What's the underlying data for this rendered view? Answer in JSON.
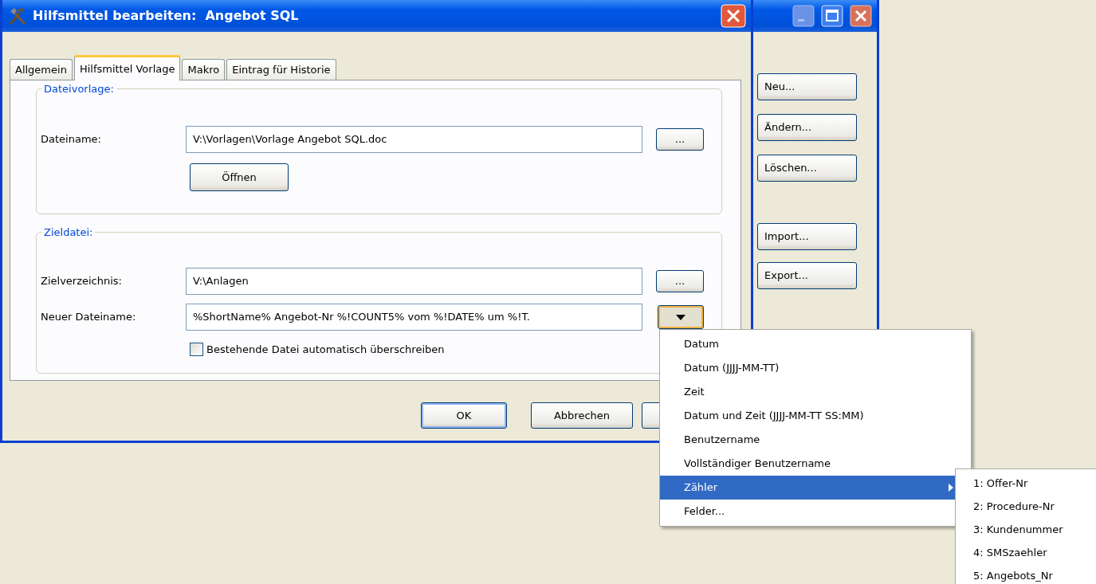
{
  "back_window": {
    "buttons": [
      "Neu...",
      "Ändern...",
      "Löschen...",
      "Import...",
      "Export..."
    ]
  },
  "dialog": {
    "title": "Hilfsmittel bearbeiten:  Angebot SQL",
    "tabs": [
      {
        "label": "Allgemein",
        "selected": false
      },
      {
        "label": "Hilfsmittel Vorlage",
        "selected": true
      },
      {
        "label": "Makro",
        "selected": false
      },
      {
        "label": "Eintrag für Historie",
        "selected": false
      }
    ],
    "groups": [
      {
        "title": "Dateivorlage:",
        "rows": [
          {
            "kind": "field",
            "label": "Dateiname:",
            "value": "V:\\Vorlagen\\Vorlage Angebot SQL.doc",
            "button": "..."
          },
          {
            "kind": "button",
            "label": "Öffnen"
          }
        ]
      },
      {
        "title": "Zieldatei:",
        "rows": [
          {
            "kind": "field",
            "label": "Zielverzeichnis:",
            "value": "V:\\Anlagen",
            "button": "..."
          },
          {
            "kind": "dropdown",
            "label": "Neuer Dateiname:",
            "value": "%ShortName% Angebot-Nr %!COUNT5% vom %!DATE% um %!T.",
            "pressed": true
          },
          {
            "kind": "checkbox",
            "label": "Bestehende Datei automatisch überschreiben",
            "checked": false
          }
        ]
      }
    ],
    "buttons": [
      "OK",
      "Abbrechen"
    ]
  },
  "menu": {
    "items": [
      {
        "label": "Datum",
        "selected": false,
        "submenu": false
      },
      {
        "label": "Datum (JJJJ-MM-TT)",
        "selected": false,
        "submenu": false
      },
      {
        "label": "Zeit",
        "selected": false,
        "submenu": false
      },
      {
        "label": "Datum und Zeit (JJJJ-MM-TT SS:MM)",
        "selected": false,
        "submenu": false
      },
      {
        "label": "Benutzername",
        "selected": false,
        "submenu": false
      },
      {
        "label": "Vollständiger Benutzername",
        "selected": false,
        "submenu": false
      },
      {
        "label": "Zähler",
        "selected": true,
        "submenu": true
      },
      {
        "label": "Felder...",
        "selected": false,
        "submenu": false
      }
    ]
  },
  "submenu": {
    "items": [
      "1: Offer-Nr",
      "2: Procedure-Nr",
      "3: Kundenummer",
      "4: SMSzaehler",
      "5: Angebots_Nr"
    ]
  }
}
